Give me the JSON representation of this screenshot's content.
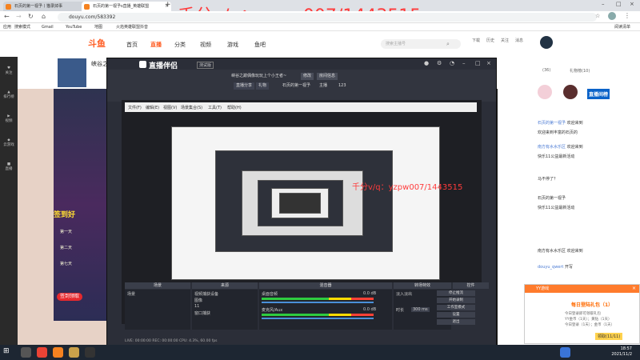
{
  "browser": {
    "tabs": [
      {
        "label": "石页的第一视予丨猫录掉事"
      },
      {
        "label": "石页的第一视予s直播_英雄联盟"
      },
      {
        "label": "千分v/q：yzpw007/1443515"
      }
    ],
    "url": "douyu.com/583392",
    "bookmarks": [
      "应用",
      "搜索模式",
      "Gmail",
      "YouTube",
      "地图",
      "火焰英雄联盟抖音"
    ],
    "reading_list": "阅读清单"
  },
  "site": {
    "logo": "斗鱼",
    "nav": [
      "首页",
      "直播",
      "分类",
      "视频",
      "游戏",
      "鱼吧"
    ],
    "search_placeholder": "搜索主播号",
    "header_labels": [
      "下载",
      "历史",
      "关注",
      "消息"
    ],
    "streamer_title": "峡谷之",
    "followers": "198500",
    "left_nav": [
      "关注",
      "排行榜",
      "视频",
      "云游戏",
      "直播"
    ],
    "badge_text": "直播间榜",
    "banner_text": "签到领取",
    "banner_days": [
      "第一天",
      "第二天",
      "第七天"
    ],
    "banner_prize": "签到好"
  },
  "watermark": {
    "text": "千分v/q：yzpw007/1443515"
  },
  "obs": {
    "app_title": "直播伴侣",
    "version": "测试版",
    "room_name": "峡谷之巅偶像玩玩上个小王者~",
    "buttons": [
      "修改",
      "房间信息",
      "直播分享",
      "礼物",
      "石页的第一视予",
      "主播",
      "123"
    ],
    "menu": [
      "文件(F)",
      "编辑(E)",
      "视图(V)",
      "场景集合(S)",
      "工具(T)",
      "帮助(H)"
    ],
    "docks": {
      "scenes": {
        "title": "场景",
        "items": [
          "场景"
        ]
      },
      "sources": {
        "title": "来源",
        "items": [
          "视频捕获设备",
          "图像",
          "11",
          "窗口捕获"
        ]
      },
      "mixer": {
        "title": "混音器",
        "items": [
          "桌面音频",
          "麦克风/Aux"
        ],
        "levels": [
          "0.0 dB",
          "0.0 dB"
        ]
      },
      "transitions": {
        "title": "转场特效",
        "items": [
          "淡出",
          "300 ms"
        ],
        "labels": [
          "淡入淡出",
          "时长"
        ]
      },
      "controls": {
        "title": "控件",
        "items": [
          "停止推流",
          "开始录制",
          "工作室模式",
          "设置",
          "退出"
        ]
      }
    },
    "status": "LIVE: 00:00:00   REC: 00:00:00   CPU: 4.3%, 60.00 fps"
  },
  "chat": {
    "messages": [
      {
        "user": "石页的第一视予",
        "text": "欢迎来到"
      },
      {
        "user": "",
        "text": "欢迎来到丰富的石页的"
      },
      {
        "user": "南方有水水乐区",
        "text": "欢迎来到"
      },
      {
        "user": "",
        "text": "快乐11公益最新活动"
      },
      {
        "user": "",
        "text": "马不停了？"
      },
      {
        "user": "",
        "text": "石页的第一视予"
      },
      {
        "user": "",
        "text": "快乐11公益最新活动"
      },
      {
        "user": "",
        "text": "南方有水水乐区 欢迎来到"
      },
      {
        "user": "douyu_qwert",
        "text": "开写"
      },
      {
        "user": "石页的第一视予",
        "text": "欢迎"
      }
    ],
    "side_labels": [
      "(36)",
      "礼物榜(10)"
    ]
  },
  "popup": {
    "title": "YY游戏",
    "heading": "每日登陆礼包（1）",
    "lines": [
      "今日登录即可领取礼包",
      "YY金币（1天）；黄钻（1天）",
      "今日登录（1天）；金币（1天）"
    ],
    "button": "领取(11/11)"
  },
  "taskbar": {
    "time": "18:57",
    "date": "2021/11/2"
  }
}
